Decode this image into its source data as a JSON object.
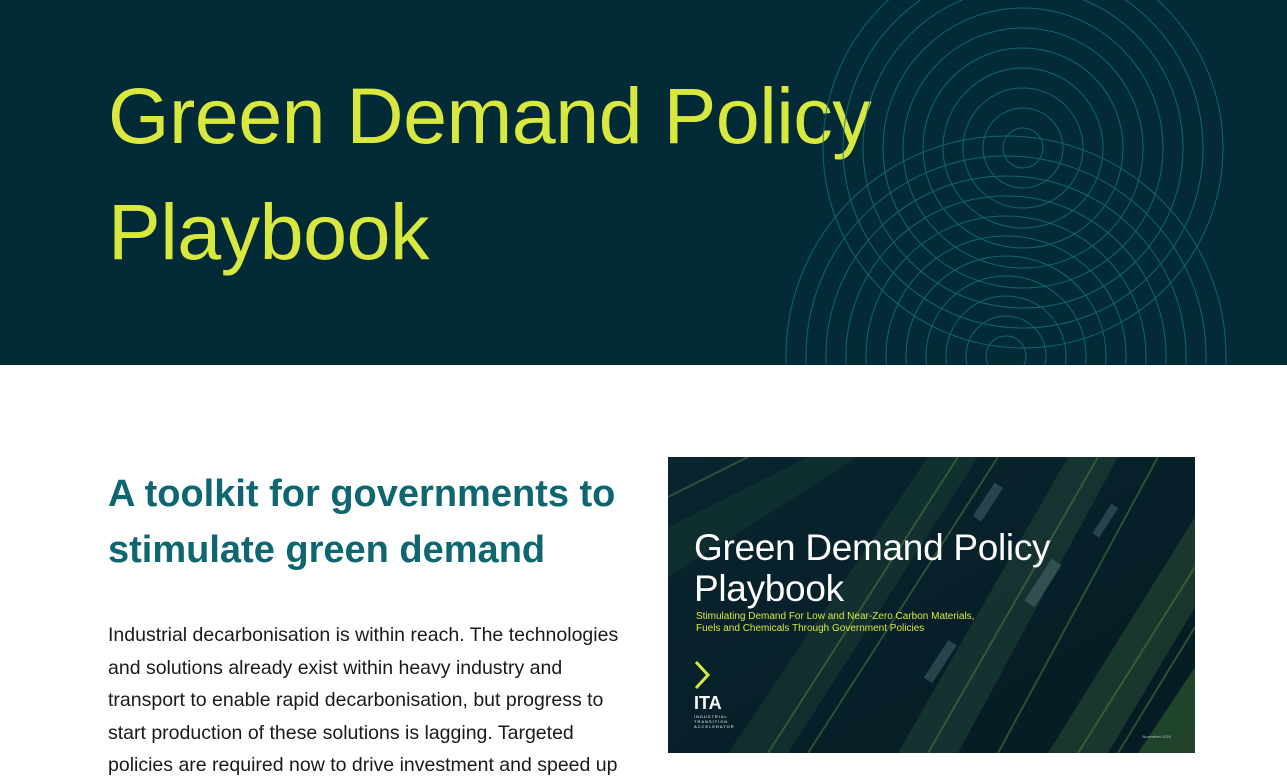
{
  "hero": {
    "title": "Green Demand Policy Playbook",
    "background_color": "#022a37",
    "title_color": "#d9e83f",
    "decoration": "concentric-rings"
  },
  "main": {
    "heading": "A toolkit for governments to stimulate green demand",
    "intro": "Industrial decarbonisation is within reach. The technologies and solutions already exist within heavy industry and transport to enable rapid decarbonisation, but progress to start production of these solutions is lagging. Targeted policies are required now to drive investment and speed up",
    "heading_color": "#0d6670"
  },
  "cover": {
    "title": "Green Demand Policy Playbook",
    "subtitle": "Stimulating Demand For Low and Near-Zero Carbon Materials, Fuels and Chemicals Through Government Policies",
    "logo_text": "ITA",
    "logo_subtext": "INDUSTRIAL TRANSITION ACCELERATOR",
    "date": "November 2024",
    "image_subject": "aerial-view-of-shipyard"
  }
}
